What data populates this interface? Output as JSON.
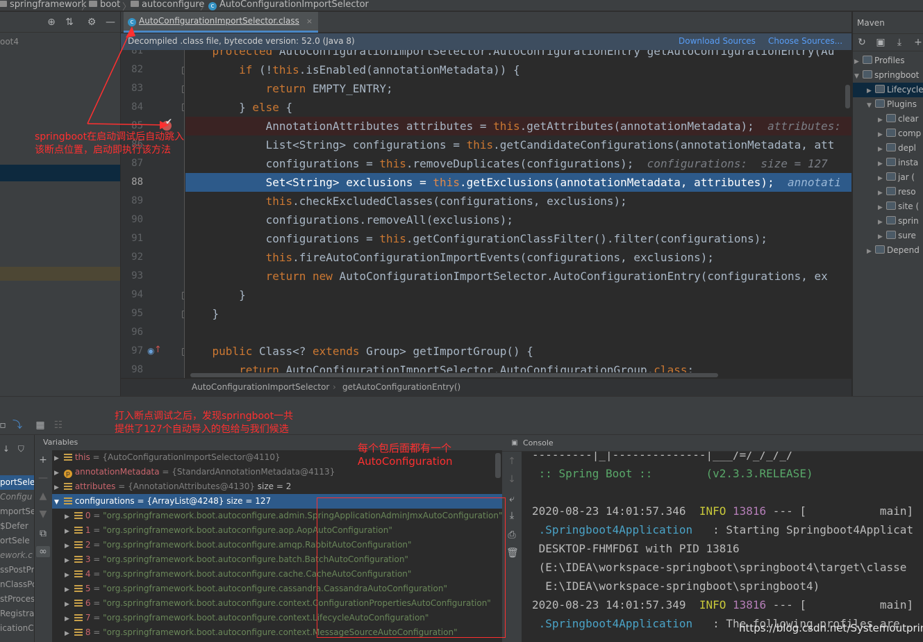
{
  "breadcrumb": {
    "items": [
      "springframework",
      "boot",
      "autoconfigure",
      "AutoConfigurationImportSelector"
    ]
  },
  "project": {
    "root_label": "oot4",
    "frame_items": [
      "portSele",
      "Configu",
      "mportSe",
      "$Defer",
      "ortSele",
      "ework.c",
      "ssPostPr",
      "nClassPo",
      "stProces",
      "Registra",
      "icationC"
    ]
  },
  "editor": {
    "tab_label": "AutoConfigurationImportSelector.class",
    "tab_close": "×",
    "banner": "Decompiled .class file, bytecode version: 52.0 (Java 8)",
    "download_sources": "Download Sources",
    "choose_sources": "Choose Sources...",
    "line_numbers": [
      "81",
      "82",
      "83",
      "84",
      "85",
      "86",
      "87",
      "88",
      "89",
      "90",
      "91",
      "92",
      "93",
      "94",
      "95",
      "96",
      "97",
      "98"
    ],
    "current_line": "88",
    "breakpoint_line": "85",
    "footer_class": "AutoConfigurationImportSelector",
    "footer_method": "getAutoConfigurationEntry()"
  },
  "maven": {
    "title": "Maven",
    "items": [
      {
        "label": "Profiles",
        "indent": 0,
        "arrow": "▶"
      },
      {
        "label": "springboot",
        "indent": 0,
        "arrow": "▼"
      },
      {
        "label": "Lifecycle",
        "indent": 1,
        "arrow": "▶"
      },
      {
        "label": "Plugins",
        "indent": 1,
        "arrow": "▼"
      },
      {
        "label": "clear",
        "indent": 2,
        "arrow": "▶"
      },
      {
        "label": "comp",
        "indent": 2,
        "arrow": "▶"
      },
      {
        "label": "depl",
        "indent": 2,
        "arrow": "▶"
      },
      {
        "label": "insta",
        "indent": 2,
        "arrow": "▶"
      },
      {
        "label": "jar (",
        "indent": 2,
        "arrow": "▶"
      },
      {
        "label": "reso",
        "indent": 2,
        "arrow": "▶"
      },
      {
        "label": "site (",
        "indent": 2,
        "arrow": "▶"
      },
      {
        "label": "sprin",
        "indent": 2,
        "arrow": "▶"
      },
      {
        "label": "sure",
        "indent": 2,
        "arrow": "▶"
      },
      {
        "label": "Depend",
        "indent": 1,
        "arrow": "▶"
      }
    ]
  },
  "debugger": {
    "variables_title": "Variables",
    "console_title": "Console",
    "variables": [
      {
        "name": "this",
        "value": " = {AutoConfigurationImportSelector@4110}",
        "extra": "",
        "icon": "field",
        "tri": "▶"
      },
      {
        "name": "annotationMetadata",
        "value": " = {StandardAnnotationMetadata@4113}",
        "extra": "",
        "icon": "param",
        "tri": "▶"
      },
      {
        "name": "attributes",
        "value": " = {AnnotationAttributes@4130}",
        "extra": "  size = 2",
        "icon": "field",
        "tri": "▶"
      },
      {
        "name": "configurations",
        "value": " = {ArrayList@4248}",
        "extra": "  size = 127",
        "icon": "field",
        "tri": "▼"
      }
    ],
    "config_items": [
      {
        "idx": "0",
        "val": "\"org.springframework.boot.autoconfigure.admin.SpringApplicationAdminJmxAutoConfiguration\""
      },
      {
        "idx": "1",
        "val": "\"org.springframework.boot.autoconfigure.aop.AopAutoConfiguration\""
      },
      {
        "idx": "2",
        "val": "\"org.springframework.boot.autoconfigure.amqp.RabbitAutoConfiguration\""
      },
      {
        "idx": "3",
        "val": "\"org.springframework.boot.autoconfigure.batch.BatchAutoConfiguration\""
      },
      {
        "idx": "4",
        "val": "\"org.springframework.boot.autoconfigure.cache.CacheAutoConfiguration\""
      },
      {
        "idx": "5",
        "val": "\"org.springframework.boot.autoconfigure.cassandra.CassandraAutoConfiguration\""
      },
      {
        "idx": "6",
        "val": "\"org.springframework.boot.autoconfigure.context.ConfigurationPropertiesAutoConfiguration\""
      },
      {
        "idx": "7",
        "val": "\"org.springframework.boot.autoconfigure.context.LifecycleAutoConfiguration\""
      },
      {
        "idx": "8",
        "val": "\"org.springframework.boot.autoconfigure.context.MessageSourceAutoConfiguration\""
      }
    ],
    "console_lines": {
      "l0": "---------|_|--------------|___/=/_/_/_/",
      "l1": " :: Spring Boot ::        (v2.3.3.RELEASE)",
      "l3_time": "2020-08-23 14:01:57.346",
      "l3_level": "INFO",
      "l3_pid": "13816",
      "l3_rest": " --- [           main]",
      "l4_cls": " .Springboot4Application",
      "l4_rest": "   : Starting Springboot4Applicat",
      "l5": " DESKTOP-FHMFD6I with PID 13816",
      "l6": " (E:\\IDEA\\workspace-springboot\\springboot4\\target\\classe",
      "l7": "  E:\\IDEA\\workspace-springboot\\springboot4)",
      "l8_time": "2020-08-23 14:01:57.349",
      "l8_level": "INFO",
      "l8_pid": "13816",
      "l8_rest": " --- [           main]",
      "l9_cls": " .Springboot4Application",
      "l9_rest": "   : The following profiles are"
    }
  },
  "annotations": {
    "note1_line1": "springboot在启动调试后自动跳入",
    "note1_line2": "该断点位置，启动即执行该方法",
    "note2_line1": "打入断点调试之后，发现springboot一共",
    "note2_line2": "提供了127个自动导入的包给与我们候选",
    "note3_line1": "每个包后面都有一个",
    "note3_line2": "AutoConfiguration",
    "watermark": "https://blog.csdn.net/Systemoutprintl"
  },
  "colors": {
    "annotation_red": "#ff3030",
    "execution_line": "#2d5a8a",
    "keyword": "#cc7832"
  }
}
